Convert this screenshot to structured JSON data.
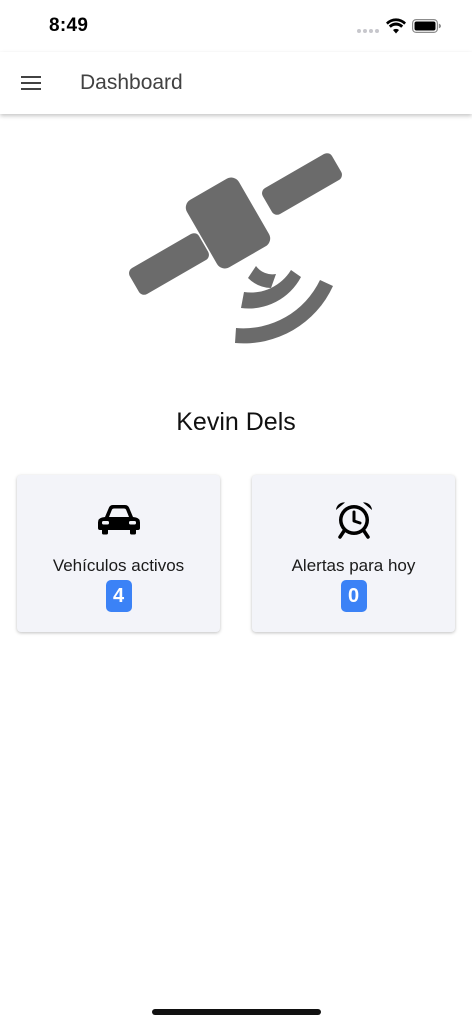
{
  "status_bar": {
    "time": "8:49",
    "icons": [
      "signal-icon",
      "wifi-icon",
      "battery-icon"
    ]
  },
  "header": {
    "menu_icon": "hamburger-menu-icon",
    "title": "Dashboard"
  },
  "hero": {
    "icon": "satellite-icon",
    "color": "#6b6b6b"
  },
  "user": {
    "name": "Kevin Dels"
  },
  "cards": [
    {
      "icon": "car-icon",
      "label": "Vehículos activos",
      "count": "4"
    },
    {
      "icon": "alarm-clock-icon",
      "label": "Alertas para hoy",
      "count": "0"
    }
  ],
  "colors": {
    "badge": "#3b82f6",
    "card_background": "#f3f4f9",
    "title_text": "#424242"
  }
}
